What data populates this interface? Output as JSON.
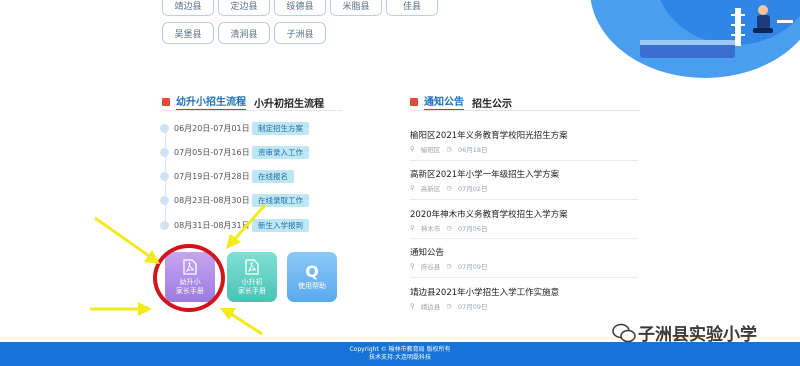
{
  "counties": {
    "row1": [
      "靖边县",
      "定边县",
      "绥德县",
      "米脂县",
      "佳县"
    ],
    "row2": [
      "吴堡县",
      "清涧县",
      "子洲县"
    ]
  },
  "left_section": {
    "tab_active": "幼升小招生流程",
    "tab_other": "小升初招生流程",
    "timeline": [
      {
        "date": "06月20日-07月01日",
        "tag": "制定招生方案"
      },
      {
        "date": "07月05日-07月16日",
        "tag": "资审录入工作"
      },
      {
        "date": "07月19日-07月28日",
        "tag": "在线报名"
      },
      {
        "date": "08月23日-08月30日",
        "tag": "在线录取工作"
      },
      {
        "date": "08月31日-08月31日",
        "tag": "新生入学报到"
      }
    ],
    "tiles": [
      {
        "line1": "幼升小",
        "line2": "家长手册"
      },
      {
        "line1": "小升初",
        "line2": "家长手册"
      },
      {
        "line1": "使用帮助",
        "glyph": "Q"
      }
    ]
  },
  "right_section": {
    "tab_active": "通知公告",
    "tab_other": "招生公示",
    "news": [
      {
        "title": "榆阳区2021年义务教育学校阳光招生方案",
        "place": "榆阳区",
        "date": "06月18日"
      },
      {
        "title": "高新区2021年小学一年级招生入学方案",
        "place": "高新区",
        "date": "07月02日"
      },
      {
        "title": "2020年神木市义务教育学校招生入学方案",
        "place": "神木市",
        "date": "07月06日"
      },
      {
        "title": "通知公告",
        "place": "府谷县",
        "date": "07月09日"
      },
      {
        "title": "靖边县2021年小学招生入学工作实施意",
        "place": "靖边县",
        "date": "07月09日"
      }
    ]
  },
  "footer": {
    "line1": "Copyright © 榆林市教育局 版权所有",
    "line2": "技术支持:大连明磊科技"
  },
  "watermark": {
    "text": "子洲县实验小学"
  },
  "colors": {
    "accent": "#1572d6",
    "highlight": "#d0161b",
    "arrow": "#f2ea1a"
  }
}
